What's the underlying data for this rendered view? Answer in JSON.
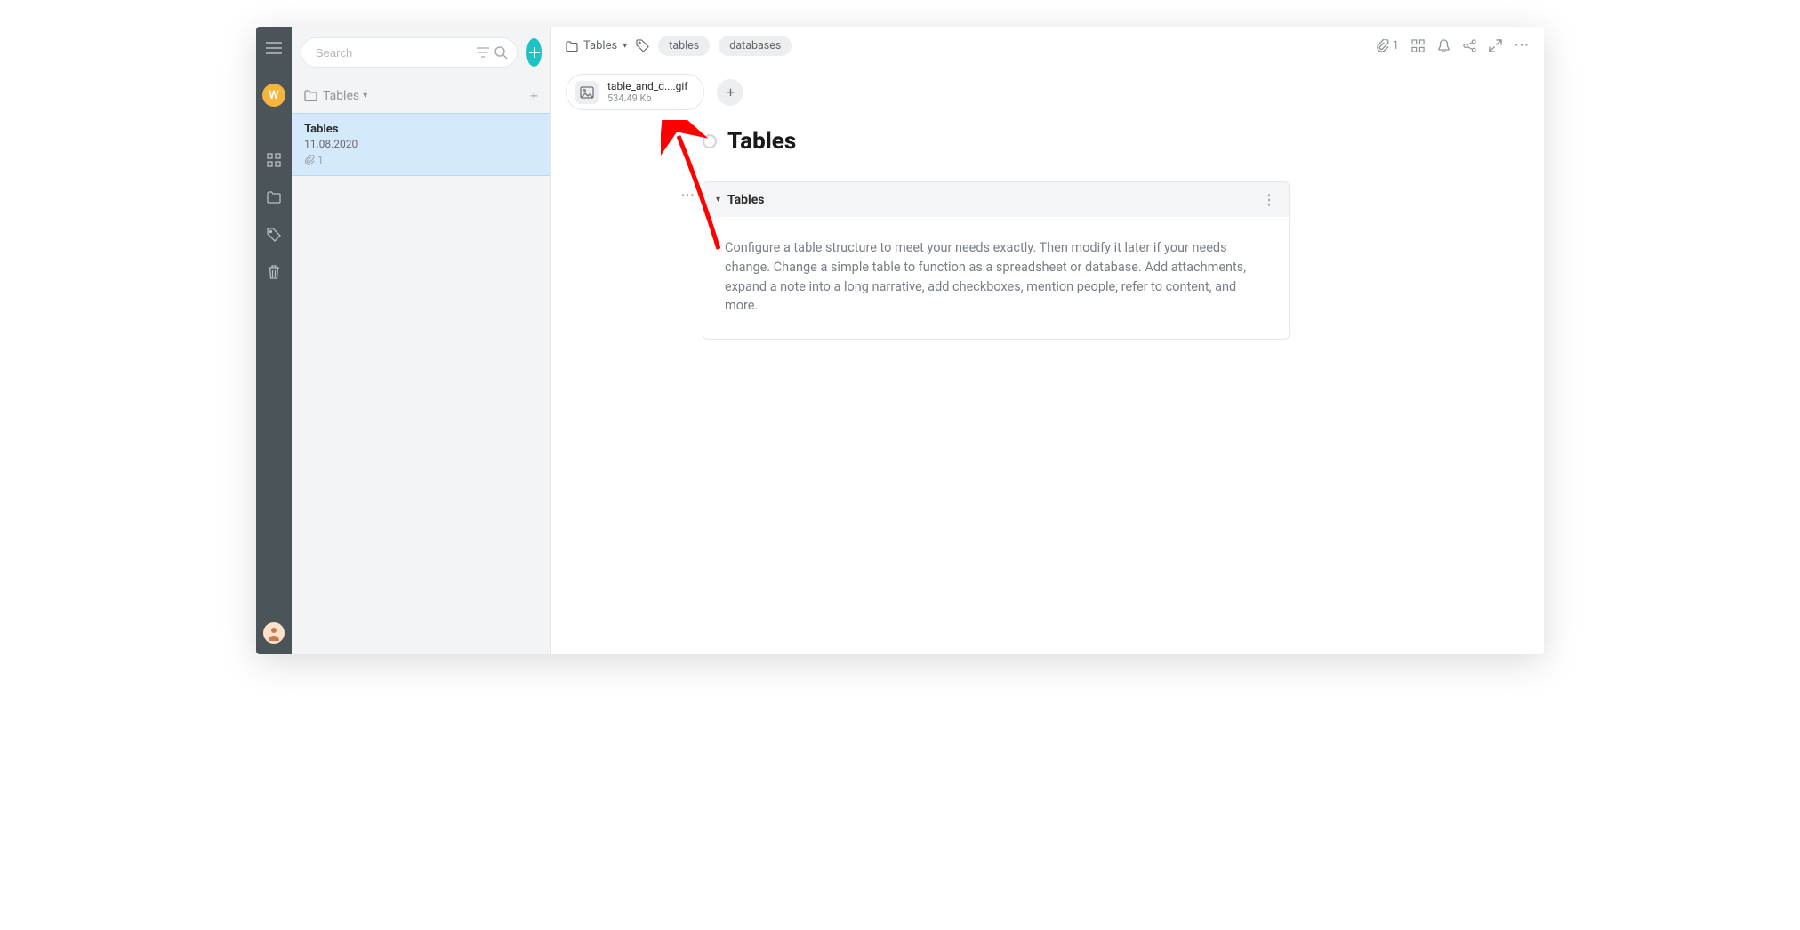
{
  "rail": {
    "avatar_letter": "W"
  },
  "search": {
    "placeholder": "Search"
  },
  "folder": {
    "name": "Tables"
  },
  "note": {
    "title": "Tables",
    "date": "11.08.2020",
    "attach_count": "1"
  },
  "breadcrumb": {
    "label": "Tables"
  },
  "tags": [
    "tables",
    "databases"
  ],
  "toolbar": {
    "attach_count": "1"
  },
  "attachment": {
    "name": "table_and_d....gif",
    "size": "534.49 Kb"
  },
  "page": {
    "title": "Tables"
  },
  "block": {
    "title": "Tables",
    "body": "Configure a table structure to meet your needs exactly. Then modify it later if your needs change. Change a simple table to function as a spreadsheet or database. Add attachments, expand a note into a long narrative, add checkboxes, mention people, refer to content, and more."
  }
}
